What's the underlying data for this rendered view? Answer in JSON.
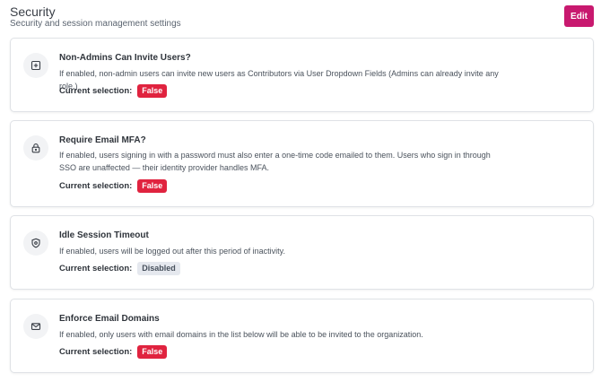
{
  "header": {
    "title": "Security",
    "subtitle": "Security and session management settings",
    "edit_label": "Edit"
  },
  "colors": {
    "accent": "#c8196f",
    "false_badge": "#e0233f",
    "disabled_badge": "#e5e8ee"
  },
  "settings": [
    {
      "icon": "plus-square-icon",
      "title": "Non-Admins Can Invite Users?",
      "description": "If enabled, non-admin users can invite new users as Contributors via User Dropdown Fields (Admins can already invite any role.)",
      "selection_label": "Current selection:",
      "value": "False"
    },
    {
      "icon": "lock-icon",
      "title": "Require Email MFA?",
      "description": "If enabled, users signing in with a password must also enter a one-time code emailed to them. Users who sign in through SSO are unaffected — their identity provider handles MFA.",
      "selection_label": "Current selection:",
      "value": "False"
    },
    {
      "icon": "shield-icon",
      "title": "Idle Session Timeout",
      "description": "If enabled, users will be logged out after this period of inactivity.",
      "selection_label": "Current selection:",
      "value": "Disabled"
    },
    {
      "icon": "envelope-icon",
      "title": "Enforce Email Domains",
      "description": "If enabled, only users with email domains in the list below will be able to be invited to the organization.",
      "selection_label": "Current selection:",
      "value": "False"
    }
  ]
}
